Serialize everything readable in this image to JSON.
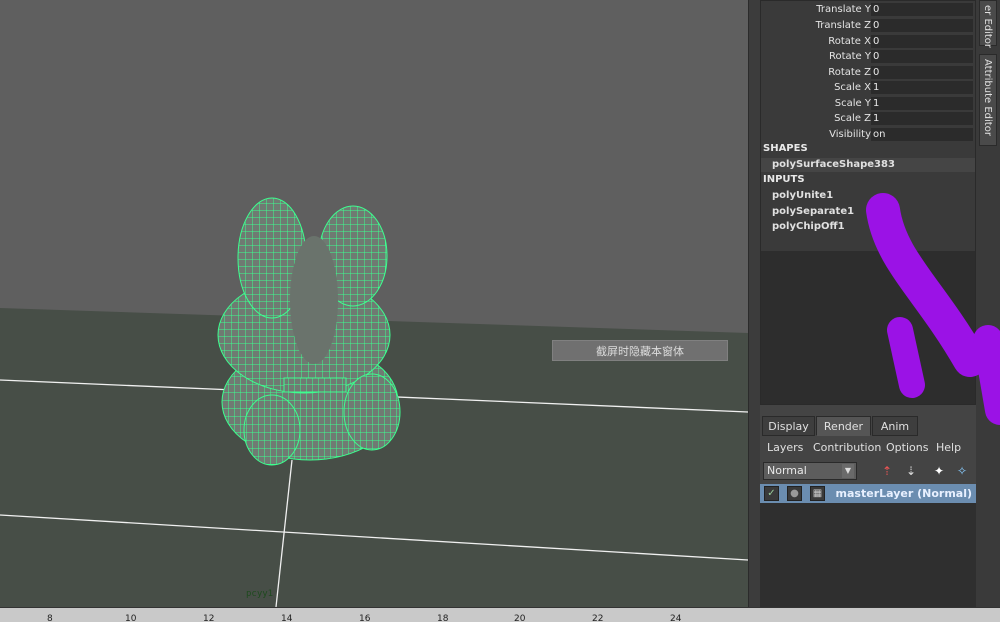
{
  "viewport": {
    "tooltip": "截屏时隐藏本窗体",
    "object_label": "pcyy1"
  },
  "timeline": {
    "ticks": [
      "8",
      "10",
      "12",
      "14",
      "16",
      "18",
      "20",
      "22",
      "24"
    ]
  },
  "channel_box": {
    "attributes": [
      {
        "label": "Translate Y",
        "value": "0"
      },
      {
        "label": "Translate Z",
        "value": "0"
      },
      {
        "label": "Rotate X",
        "value": "0"
      },
      {
        "label": "Rotate Y",
        "value": "0"
      },
      {
        "label": "Rotate Z",
        "value": "0"
      },
      {
        "label": "Scale X",
        "value": "1"
      },
      {
        "label": "Scale Y",
        "value": "1"
      },
      {
        "label": "Scale Z",
        "value": "1"
      },
      {
        "label": "Visibility",
        "value": "on"
      }
    ],
    "shapes_header": "SHAPES",
    "shape": "polySurfaceShape383",
    "inputs_header": "INPUTS",
    "inputs": [
      "polyUnite1",
      "polySeparate1",
      "polyChipOff1"
    ]
  },
  "side_tabs": {
    "top": "er Editor",
    "attribute_editor": "Attribute Editor"
  },
  "layer_editor": {
    "tabs": [
      "Display",
      "Render",
      "Anim"
    ],
    "active_tab": "Render",
    "menu": [
      "Layers",
      "Contribution",
      "Options",
      "Help"
    ],
    "mode": "Normal",
    "layer_name": "masterLayer (Normal)"
  },
  "colors": {
    "wireframe": "#3dff8f",
    "selection": "#6b8db0",
    "scribble": "#9b12e6"
  }
}
